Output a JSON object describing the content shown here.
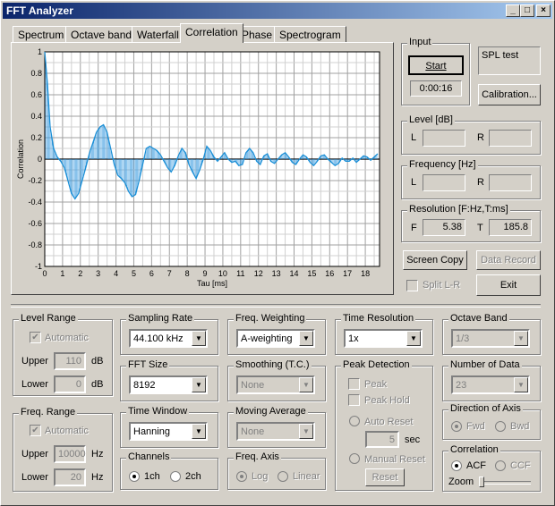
{
  "window": {
    "title": "FFT Analyzer"
  },
  "tabs": [
    "Spectrum",
    "Octave band",
    "Waterfall",
    "Correlation",
    "Phase",
    "Spectrogram"
  ],
  "active_tab": "Correlation",
  "input": {
    "label": "Input",
    "start": "Start",
    "elapsed": "0:00:16",
    "device": "SPL test",
    "calibration": "Calibration..."
  },
  "level": {
    "label": "Level [dB]",
    "l": "L",
    "r": "R",
    "l_value": "",
    "r_value": ""
  },
  "frequency": {
    "label": "Frequency [Hz]",
    "l": "L",
    "r": "R",
    "l_value": "",
    "r_value": ""
  },
  "resolution": {
    "label": "Resolution [F:Hz,T:ms]",
    "f": "F",
    "t": "T",
    "f_value": "5.38",
    "t_value": "185.8"
  },
  "buttons": {
    "screen_copy": "Screen Copy",
    "data_record": "Data Record",
    "split": "Split L-R",
    "exit": "Exit"
  },
  "level_range": {
    "label": "Level Range",
    "automatic": "Automatic",
    "upper": "Upper",
    "upper_value": "110",
    "lower": "Lower",
    "lower_value": "0",
    "unit": "dB"
  },
  "freq_range": {
    "label": "Freq. Range",
    "automatic": "Automatic",
    "upper": "Upper",
    "upper_value": "10000",
    "lower": "Lower",
    "lower_value": "20",
    "unit": "Hz"
  },
  "sampling_rate": {
    "label": "Sampling Rate",
    "value": "44.100 kHz"
  },
  "fft_size": {
    "label": "FFT Size",
    "value": "8192"
  },
  "time_window": {
    "label": "Time Window",
    "value": "Hanning"
  },
  "channels": {
    "label": "Channels",
    "opt1": "1ch",
    "opt2": "2ch"
  },
  "freq_weighting": {
    "label": "Freq. Weighting",
    "value": "A-weighting"
  },
  "smoothing": {
    "label": "Smoothing (T.C.)",
    "value": "None"
  },
  "moving_average": {
    "label": "Moving Average",
    "value": "None"
  },
  "freq_axis": {
    "label": "Freq. Axis",
    "opt1": "Log",
    "opt2": "Linear"
  },
  "time_resolution": {
    "label": "Time Resolution",
    "value": "1x"
  },
  "peak_detection": {
    "label": "Peak Detection",
    "peak": "Peak",
    "peak_hold": "Peak Hold",
    "auto_reset": "Auto Reset",
    "auto_value": "5",
    "sec": "sec",
    "manual_reset": "Manual Reset",
    "reset": "Reset"
  },
  "octave_band": {
    "label": "Octave Band",
    "value": "1/3"
  },
  "number_of_data": {
    "label": "Number of Data",
    "value": "23"
  },
  "direction": {
    "label": "Direction of Axis",
    "opt1": "Fwd",
    "opt2": "Bwd"
  },
  "correlation": {
    "label": "Correlation",
    "opt1": "ACF",
    "opt2": "CCF",
    "zoom": "Zoom"
  },
  "chart_data": {
    "type": "line",
    "xlabel": "Tau [ms]",
    "ylabel": "Correlation",
    "xlim": [
      0,
      18.8
    ],
    "ylim": [
      -1,
      1
    ],
    "x_ticks": [
      "0",
      "1",
      "2",
      "3",
      "4",
      "5",
      "6",
      "7",
      "8",
      "9",
      "10",
      "11",
      "12",
      "13",
      "14",
      "15",
      "16",
      "17",
      "18"
    ],
    "y_ticks": [
      "1",
      "0.8",
      "0.6",
      "0.4",
      "0.2",
      "0",
      "-0.2",
      "-0.4",
      "-0.6",
      "-0.8",
      "-1"
    ],
    "grid": true,
    "series": [
      {
        "x": [
          0,
          0.15,
          0.3,
          0.5,
          0.7,
          0.9,
          1.1,
          1.3,
          1.5,
          1.7,
          1.9,
          2.1,
          2.3,
          2.5,
          2.7,
          2.9,
          3.1,
          3.3,
          3.5,
          3.7,
          3.9,
          4.1,
          4.3,
          4.5,
          4.7,
          4.9,
          5.1,
          5.3,
          5.5,
          5.7,
          5.9,
          6.1,
          6.3,
          6.5,
          6.7,
          6.9,
          7.1,
          7.3,
          7.5,
          7.7,
          7.9,
          8.1,
          8.3,
          8.5,
          8.7,
          8.9,
          9.1,
          9.3,
          9.5,
          9.7,
          9.9,
          10.1,
          10.3,
          10.5,
          10.7,
          10.9,
          11.1,
          11.3,
          11.5,
          11.7,
          11.9,
          12.1,
          12.3,
          12.5,
          12.7,
          12.9,
          13.1,
          13.3,
          13.5,
          13.7,
          13.9,
          14.1,
          14.3,
          14.5,
          14.7,
          14.9,
          15.1,
          15.3,
          15.5,
          15.7,
          15.9,
          16.1,
          16.3,
          16.5,
          16.7,
          16.9,
          17.1,
          17.3,
          17.5,
          17.7,
          17.9,
          18.1,
          18.3,
          18.5,
          18.7
        ],
        "y": [
          1,
          0.7,
          0.3,
          0.1,
          0.02,
          -0.02,
          -0.08,
          -0.2,
          -0.32,
          -0.37,
          -0.32,
          -0.2,
          -0.08,
          0.05,
          0.15,
          0.25,
          0.3,
          0.32,
          0.25,
          0.1,
          -0.05,
          -0.15,
          -0.18,
          -0.22,
          -0.3,
          -0.35,
          -0.33,
          -0.2,
          -0.05,
          0.1,
          0.12,
          0.1,
          0.08,
          0.04,
          -0.02,
          -0.08,
          -0.12,
          -0.06,
          0.03,
          0.1,
          0.06,
          -0.05,
          -0.12,
          -0.18,
          -0.1,
          0.0,
          0.12,
          0.08,
          0.02,
          -0.02,
          0.02,
          0.06,
          0.0,
          -0.03,
          -0.02,
          -0.06,
          -0.05,
          0.06,
          0.1,
          0.06,
          -0.02,
          -0.05,
          0.03,
          0.05,
          -0.02,
          -0.04,
          0.0,
          0.04,
          0.06,
          0.02,
          -0.03,
          -0.05,
          0.0,
          0.04,
          0.02,
          -0.03,
          -0.06,
          -0.02,
          0.03,
          0.04,
          0.0,
          -0.03,
          -0.06,
          -0.04,
          0.01,
          -0.02,
          -0.02,
          0.01,
          -0.03,
          0.0,
          0.03,
          0.02,
          -0.01,
          0.02,
          0.05
        ]
      }
    ]
  }
}
